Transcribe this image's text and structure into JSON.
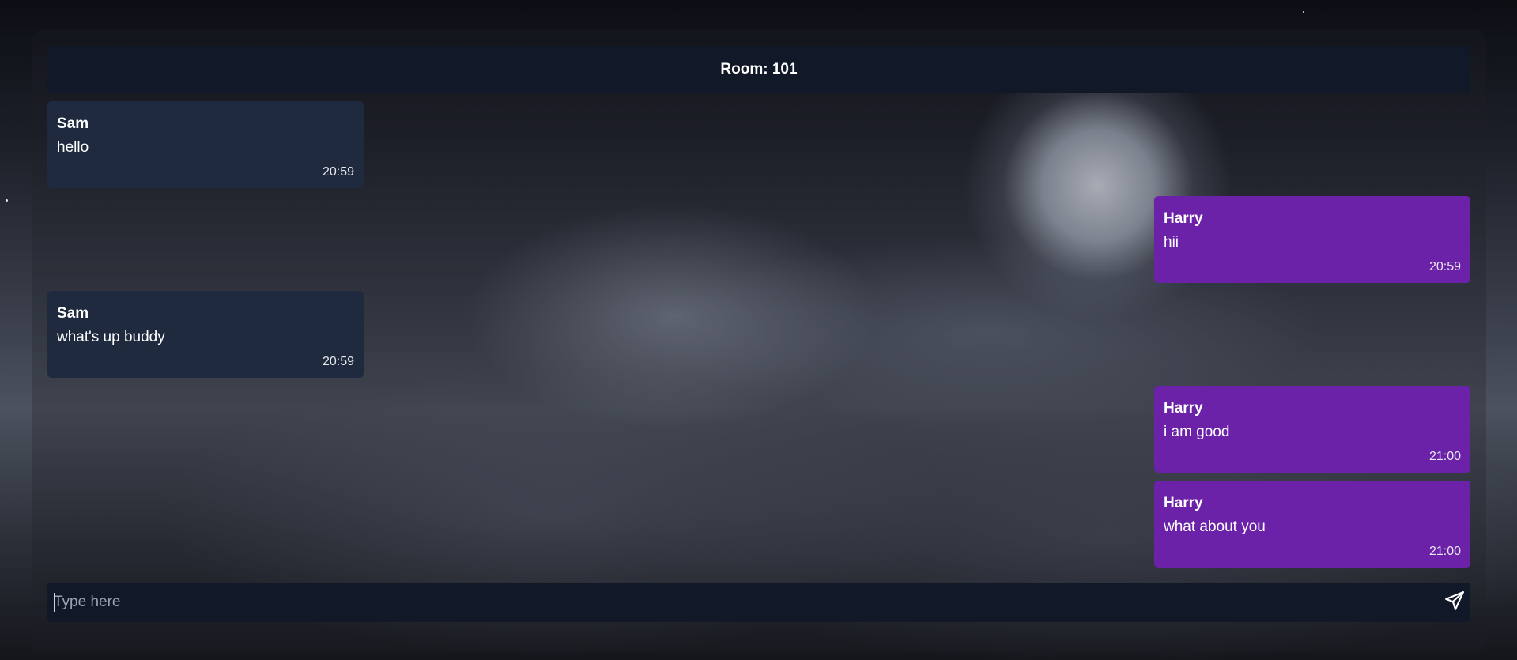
{
  "room": {
    "title": "Room: 101"
  },
  "messages": [
    {
      "sender": "Sam",
      "text": "hello",
      "time": "20:59",
      "side": "left"
    },
    {
      "sender": "Harry",
      "text": "hii",
      "time": "20:59",
      "side": "right"
    },
    {
      "sender": "Sam",
      "text": "what's up buddy",
      "time": "20:59",
      "side": "left"
    },
    {
      "sender": "Harry",
      "text": "i am good",
      "time": "21:00",
      "side": "right"
    },
    {
      "sender": "Harry",
      "text": "what about you",
      "time": "21:00",
      "side": "right"
    }
  ],
  "composer": {
    "placeholder": "Type here",
    "value": "",
    "send_icon": "send-icon"
  },
  "colors": {
    "header_bg": "#111827",
    "incoming_bubble": "#1f2a3e",
    "outgoing_bubble": "#6b21a8"
  }
}
